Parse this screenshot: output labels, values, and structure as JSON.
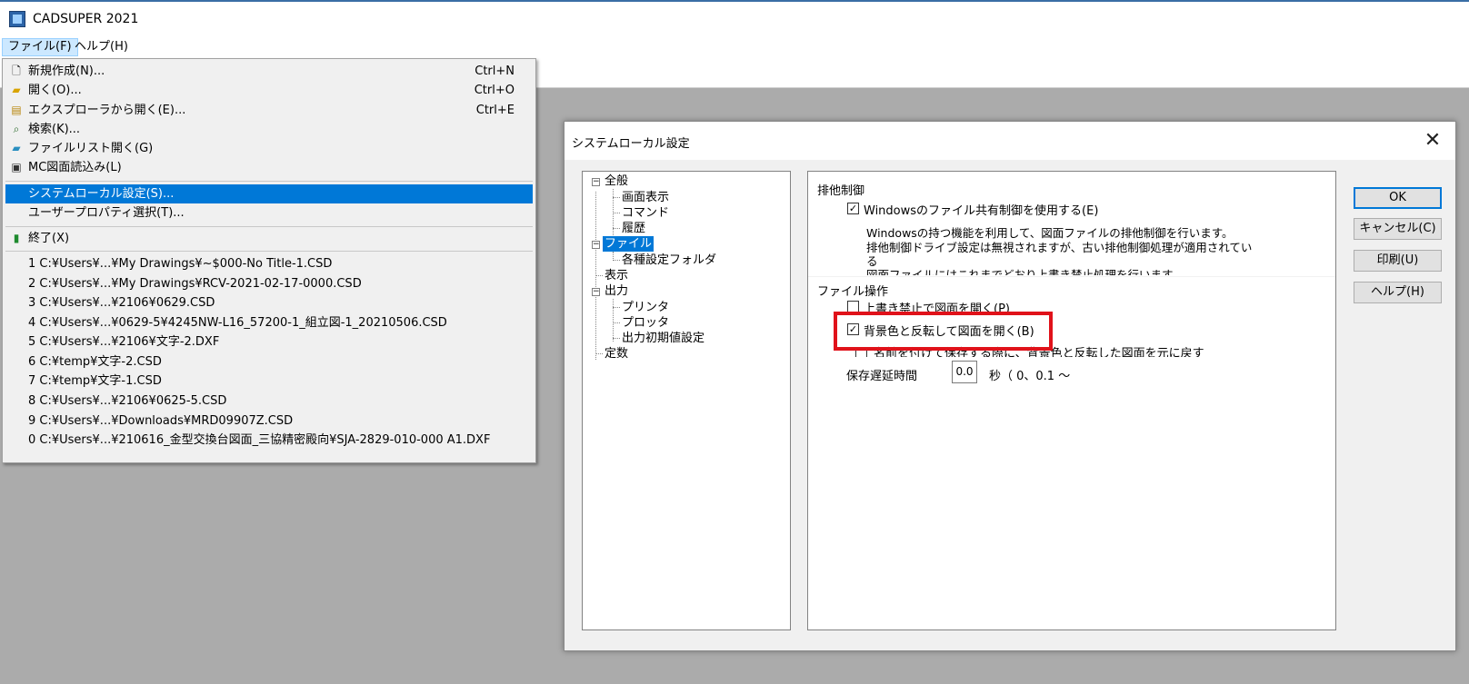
{
  "app": {
    "title": "CADSUPER 2021"
  },
  "menubar": {
    "file": "ファイル(F)",
    "help": "ヘルプ(H)"
  },
  "file_menu": {
    "items": [
      {
        "icon": "new-document-icon",
        "label": "新規作成(N)...",
        "shortcut": "Ctrl+N"
      },
      {
        "icon": "open-folder-icon",
        "label": "開く(O)...",
        "shortcut": "Ctrl+O"
      },
      {
        "icon": "explorer-icon",
        "label": "エクスプローラから開く(E)...",
        "shortcut": "Ctrl+E"
      },
      {
        "icon": "search-icon",
        "label": "検索(K)...",
        "shortcut": ""
      },
      {
        "icon": "file-list-icon",
        "label": "ファイルリスト開く(G)",
        "shortcut": ""
      },
      {
        "icon": "mc-drawing-icon",
        "label": "MC図面読込み(L)",
        "shortcut": ""
      },
      {
        "icon": "",
        "label": "システムローカル設定(S)...",
        "shortcut": "",
        "highlighted": true
      },
      {
        "icon": "",
        "label": "ユーザープロパティ選択(T)...",
        "shortcut": ""
      },
      {
        "icon": "exit-icon",
        "label": "終了(X)",
        "shortcut": ""
      }
    ],
    "recent_files": [
      "1 C:¥Users¥...¥My Drawings¥~$000-No Title-1.CSD",
      "2 C:¥Users¥...¥My Drawings¥RCV-2021-02-17-0000.CSD",
      "3 C:¥Users¥...¥2106¥0629.CSD",
      "4 C:¥Users¥...¥0629-5¥4245NW-L16_57200-1_組立図-1_20210506.CSD",
      "5 C:¥Users¥...¥2106¥文字-2.DXF",
      "6 C:¥temp¥文字-2.CSD",
      "7 C:¥temp¥文字-1.CSD",
      "8 C:¥Users¥...¥2106¥0625-5.CSD",
      "9 C:¥Users¥...¥Downloads¥MRD09907Z.CSD",
      "0 C:¥Users¥...¥210616_金型交換台図面_三協精密殿向¥SJA-2829-010-000 A1.DXF"
    ]
  },
  "dialog": {
    "title": "システムローカル設定",
    "close": "✕",
    "tree": {
      "general": "全般",
      "screen": "画面表示",
      "command": "コマンド",
      "history": "履歴",
      "file": "ファイル",
      "folders": "各種設定フォルダ",
      "display": "表示",
      "output": "出力",
      "printer": "プリンタ",
      "plotter": "プロッタ",
      "output_defaults": "出力初期値設定",
      "constants": "定数"
    },
    "panel": {
      "exclusive_heading": "排他制御",
      "windows_share_label": "Windowsのファイル共有制御を使用する(E)",
      "windows_share_checked": true,
      "desc_line1": "Windowsの持つ機能を利用して、図面ファイルの排他制御を行います。",
      "desc_line2": "排他制御ドライブ設定は無視されますが、古い排他制御処理が適用されてい",
      "desc_line3": "る",
      "desc_line4": "図面ファイルにはこれまでどおり上書き禁止処理を行います。",
      "file_ops_heading": "ファイル操作",
      "overwrite_label": "上書き禁止で図面を開く(P)",
      "overwrite_checked": false,
      "invert_label": "背景色と反転して図面を開く(B)",
      "invert_checked": true,
      "restore_label": "名前を付けて保存する際に、背景色と反転した図面を元に戻す",
      "restore_checked": false,
      "delay_label": "保存遅延時間",
      "delay_value": "0.0",
      "delay_unit": "秒（ 0、0.1 〜"
    },
    "buttons": {
      "ok": "OK",
      "cancel": "キャンセル(C)",
      "print": "印刷(U)",
      "help": "ヘルプ(H)"
    }
  },
  "colors": {
    "highlight_box": "#e0121a",
    "selection": "#0078d7",
    "desktop": "#ababab"
  }
}
